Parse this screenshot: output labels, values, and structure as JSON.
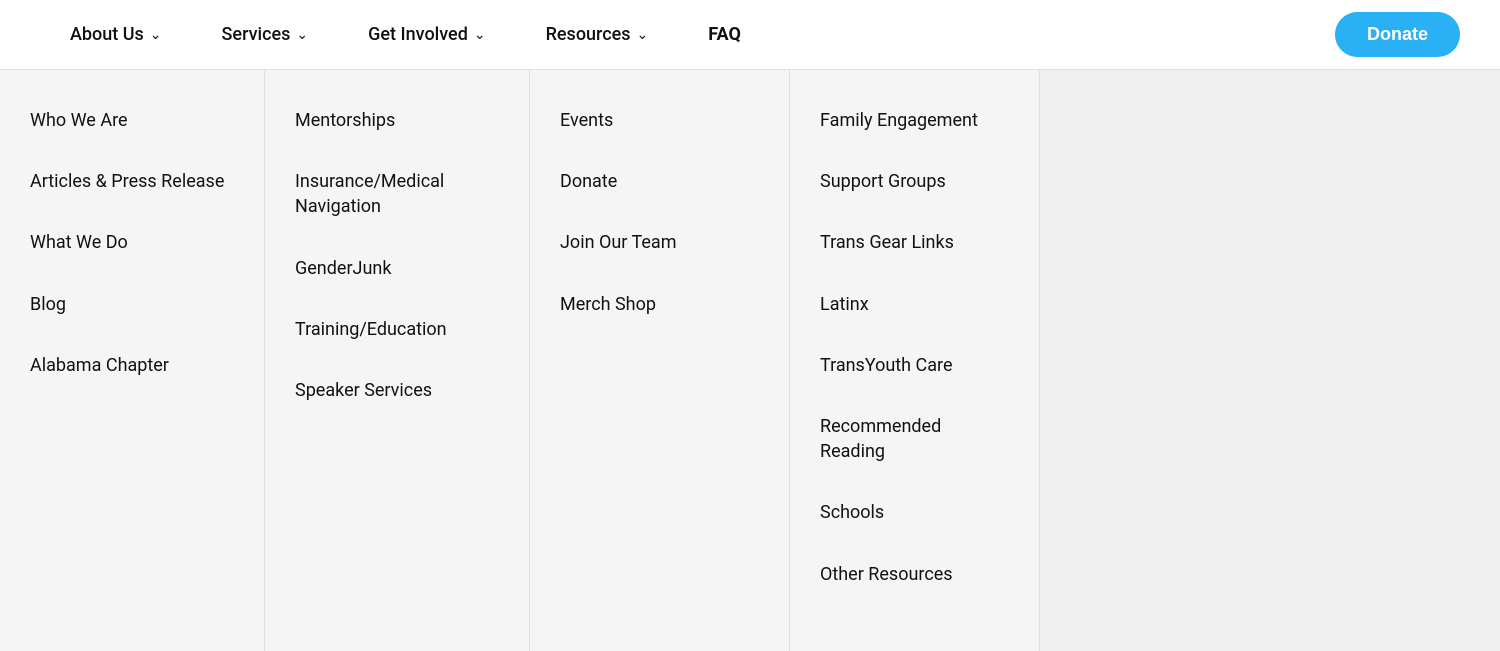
{
  "navbar": {
    "about_us": "About Us",
    "services": "Services",
    "get_involved": "Get Involved",
    "resources": "Resources",
    "faq": "FAQ",
    "donate_btn": "Donate"
  },
  "about_us_items": [
    "Who We Are",
    "Articles & Press Release",
    "What We Do",
    "Blog",
    "Alabama Chapter"
  ],
  "services_items": [
    "Mentorships",
    "Insurance/Medical Navigation",
    "GenderJunk",
    "Training/Education",
    "Speaker Services"
  ],
  "get_involved_items": [
    "Events",
    "Donate",
    "Join Our Team",
    "Merch Shop"
  ],
  "resources_items": [
    "Family Engagement",
    "Support Groups",
    "Trans Gear Links",
    "Latinx",
    "TransYouth Care",
    "Recommended Reading",
    "Schools",
    "Other Resources"
  ]
}
